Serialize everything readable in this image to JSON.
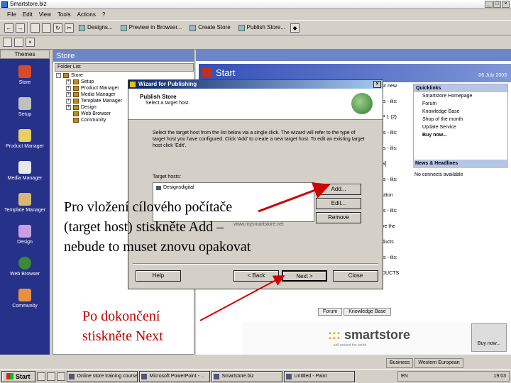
{
  "window": {
    "title": "Smartstore.biz"
  },
  "menu": [
    "File",
    "Edit",
    "View",
    "Tools",
    "Actions",
    "?"
  ],
  "toolbar": {
    "buttons": [
      "Designs...",
      "Preview in Browser...",
      "Create Store",
      "Publish Store..."
    ]
  },
  "left_bar": {
    "header": "Themes",
    "items": [
      "Store",
      "Setup",
      "Product Manager",
      "Media Manager",
      "Template Manager",
      "Design",
      "Web Browser",
      "Community"
    ]
  },
  "store_pane": {
    "title": "Store",
    "folder_list_label": "Folder List",
    "tree": {
      "root": "Store",
      "children": [
        "Setup",
        "Product Manager",
        "Media Manager",
        "Template Manager",
        "Design",
        "Web Browser",
        "Community"
      ]
    }
  },
  "start_pane": {
    "title": "Start",
    "date": "06 July 2003",
    "quicklinks_header": "Quicklinks",
    "quicklinks": [
      "Smartstore Homepage",
      "Forum",
      "Knowledge Base",
      "Shop of the month",
      "Update Service",
      "Buy now..."
    ],
    "news_header": "News & Headlines",
    "news_line": "No connects available",
    "tabs": [
      "Forum",
      "Knowledge Base"
    ],
    "brand_logo": "smartstore",
    "brand_dot": ":::",
    "brand_sub": "sell around the world",
    "buy_now": "Buy now...",
    "news_fragments": [
      "ur new",
      "ts - ilis:",
      "P 1 (2)",
      "ts - ilis:",
      "ts - ilis:",
      "S]",
      "ts - ilis:",
      "utton",
      "ts - ilis:",
      "ve the",
      "ducts",
      "ts - ilis:",
      "DUCTS"
    ]
  },
  "wizard": {
    "title": "Wizard for Publishing",
    "header_title": "Publish Store",
    "header_sub": "Select a target host.",
    "instructions": "Select the target host from the list below via a single click. The wizard will refer to the type of target host you have configured. Click 'Add' to create a new target host. To edit an existing target host click 'Edit'.",
    "target_hosts_label": "Target hosts:",
    "target_hosts": [
      "Designsdigital"
    ],
    "ghost_text": "www.mysmartstore.net",
    "buttons": {
      "add": "Add...",
      "edit": "Edit...",
      "remove": "Remove",
      "help": "Help",
      "back": "< Back",
      "next": "Next >",
      "close": "Close"
    }
  },
  "annotations": {
    "add_hint": "Pro vložení cílového počítače (target host) stiskněte Add – nebude to muset znovu opakovat",
    "next_hint": "Po dokončení stiskněte Next",
    "color_next": "#c00000"
  },
  "taskbar": {
    "start": "Start",
    "items": [
      "Online store training course...",
      "Microsoft PowerPoint - ...",
      "Smartstore.biz",
      "Untitled - Paint"
    ],
    "clock": "19:03",
    "lang": "EN"
  },
  "statusbar": {
    "left": "Business",
    "right": "Western European"
  }
}
